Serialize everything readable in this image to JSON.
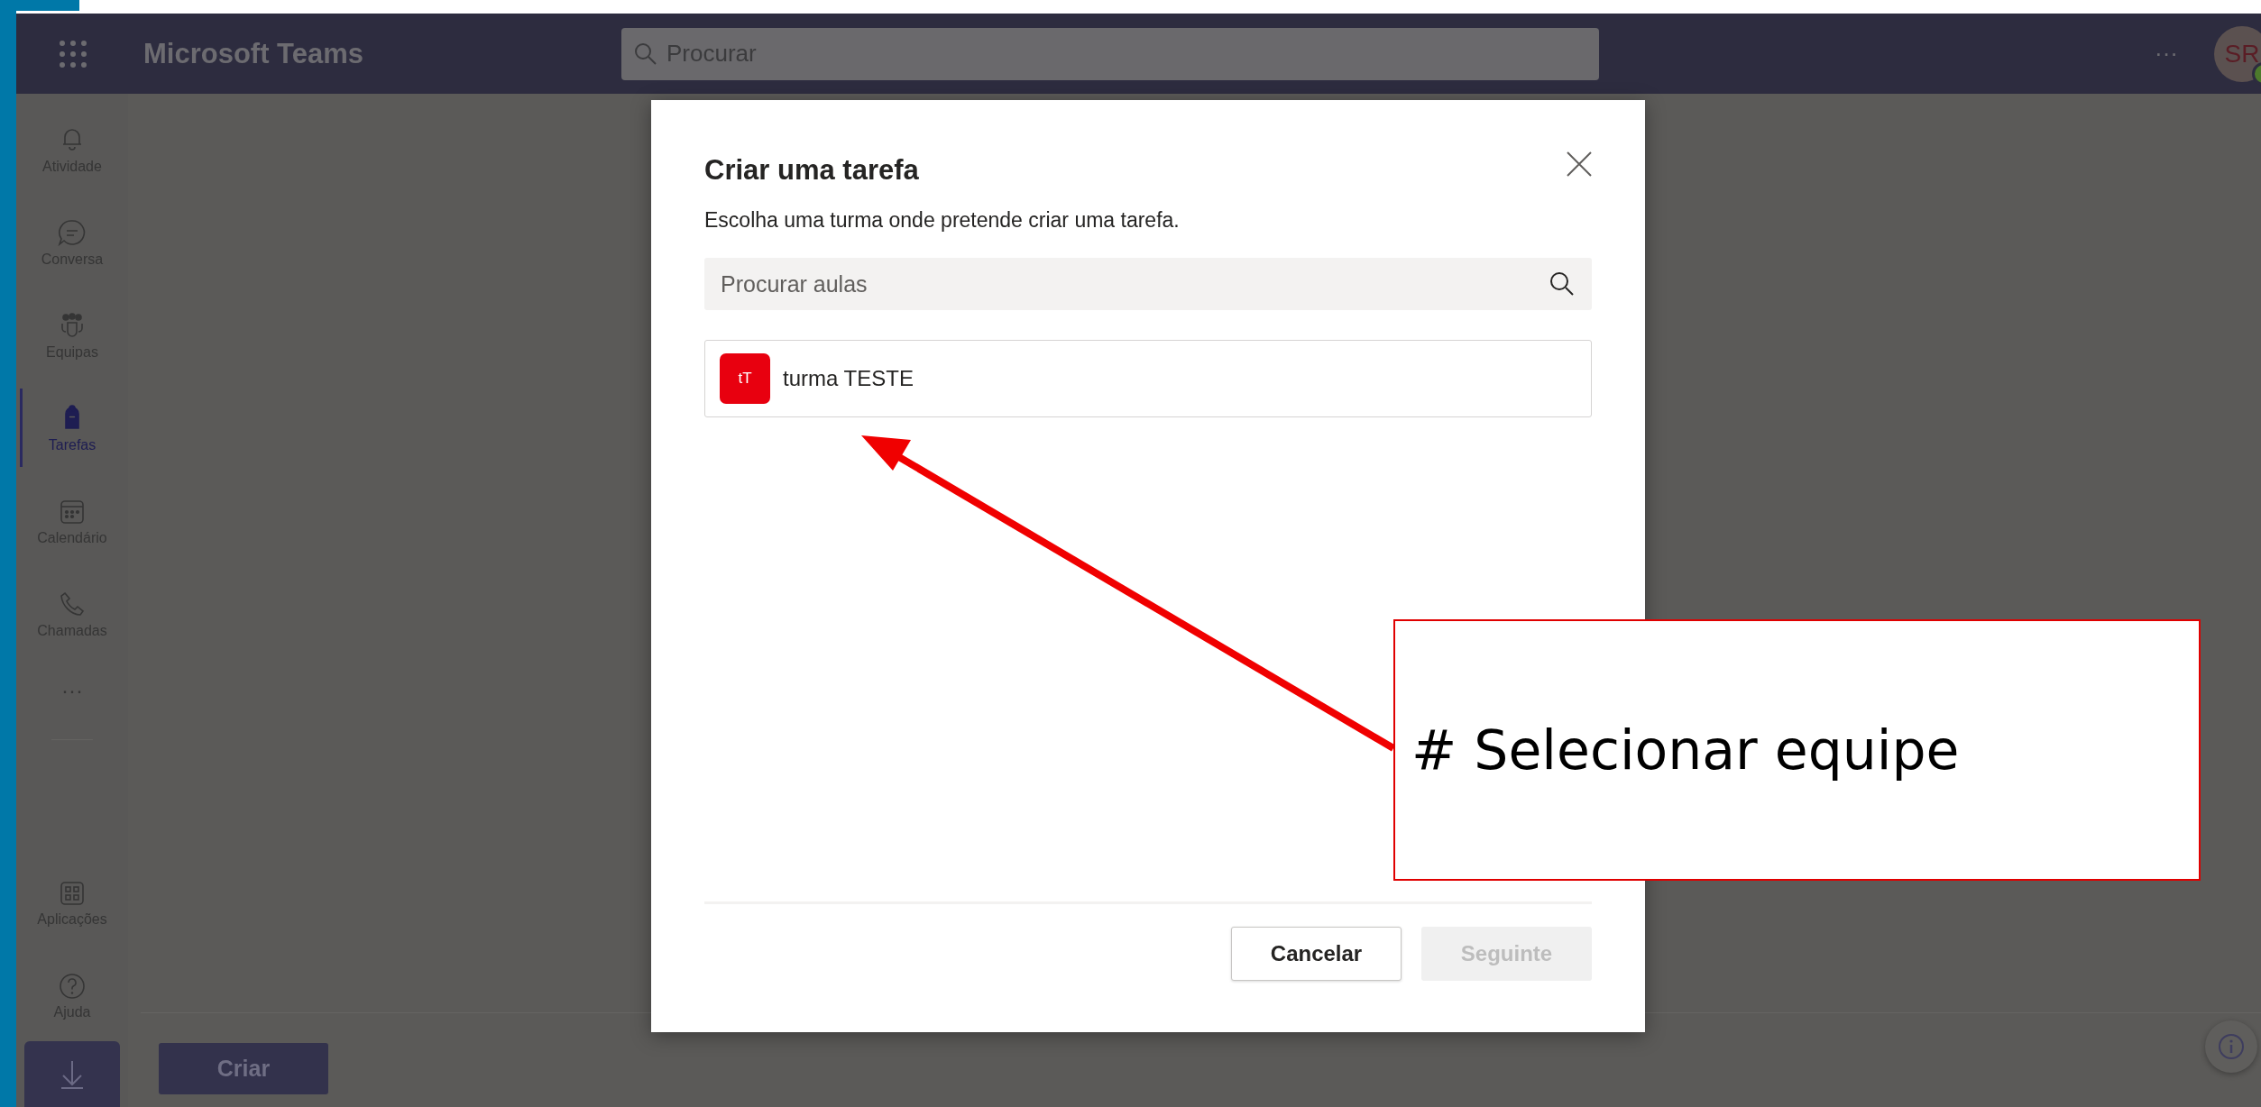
{
  "top_bar": {
    "title": "Microsoft Teams",
    "search_placeholder": "Procurar",
    "more": "···",
    "avatar_initials": "SR"
  },
  "sidebar": {
    "items": [
      {
        "label": "Atividade",
        "selected": false
      },
      {
        "label": "Conversa",
        "selected": false
      },
      {
        "label": "Equipas",
        "selected": false
      },
      {
        "label": "Tarefas",
        "selected": true
      },
      {
        "label": "Calendário",
        "selected": false
      },
      {
        "label": "Chamadas",
        "selected": false
      }
    ],
    "more": "···",
    "bottom_items": [
      {
        "label": "Aplicações",
        "selected": false
      },
      {
        "label": "Ajuda",
        "selected": false
      }
    ]
  },
  "footer": {
    "create_button": "Criar"
  },
  "dialog": {
    "title": "Criar uma tarefa",
    "subtitle": "Escolha uma turma onde pretende criar uma tarefa.",
    "search_placeholder": "Procurar aulas",
    "classes": [
      {
        "initials": "tT",
        "name": "turma TESTE",
        "selected": false
      }
    ],
    "buttons": [
      {
        "label": "Cancelar",
        "kind": "secondary",
        "disabled": false
      },
      {
        "label": "Seguinte",
        "kind": "primary",
        "disabled": true
      }
    ]
  },
  "annotation": {
    "text": "# Selecionar equipe"
  }
}
